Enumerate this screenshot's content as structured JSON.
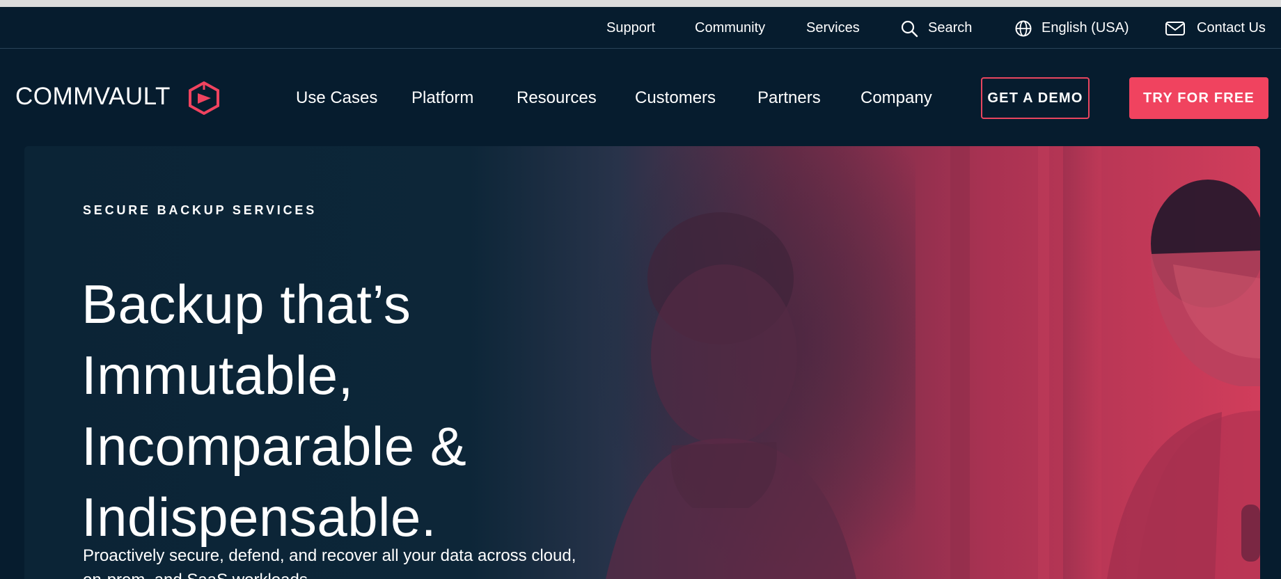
{
  "utility_nav": {
    "support": "Support",
    "community": "Community",
    "services": "Services",
    "search": "Search",
    "language": "English (USA)",
    "contact": "Contact Us",
    "icons": [
      "search-icon",
      "globe-icon",
      "mail-icon"
    ]
  },
  "main_nav": {
    "logo_text": "COMMVAULT",
    "items": [
      "Use Cases",
      "Platform",
      "Resources",
      "Customers",
      "Partners",
      "Company"
    ],
    "demo_label": "GET A DEMO",
    "free_label": "TRY FOR FREE"
  },
  "hero": {
    "eyebrow": "SECURE BACKUP SERVICES",
    "headline_lines": [
      "Backup that’s",
      "Immutable,",
      "Incomparable &",
      "Indispensable."
    ],
    "subtitle": "Proactively secure, defend, and recover all your data across cloud, on-prem, and SaaS workloads."
  },
  "colors": {
    "background": "#061c2e",
    "accent": "#f0435f",
    "hero_overlay": "#b83453",
    "text": "#ffffff"
  }
}
